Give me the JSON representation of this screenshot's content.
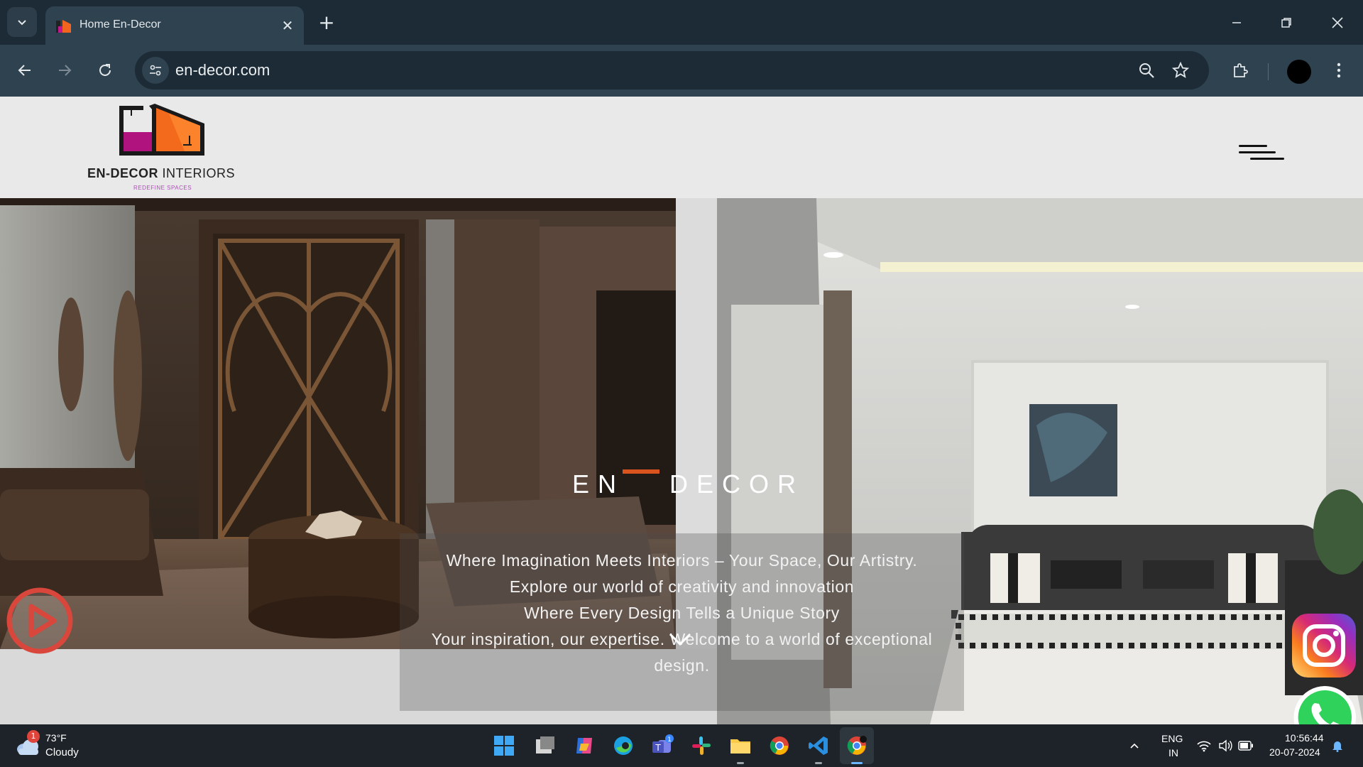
{
  "browser": {
    "tab_title": "Home En-Decor",
    "url": "en-decor.com",
    "icons": [
      "tab-search-icon",
      "close-icon",
      "plus-icon",
      "minimize-icon",
      "restore-icon",
      "close-window-icon",
      "back-icon",
      "forward-icon",
      "reload-icon",
      "site-settings-icon",
      "zoom-icon",
      "star-icon",
      "extensions-icon",
      "profile-avatar",
      "more-icon"
    ]
  },
  "site": {
    "brand_bold": "EN-DECOR",
    "brand_rest": " INTERIORS",
    "tagline": "REDEFINE SPACES",
    "hero_en": "EN",
    "hero_decor": "DECOR",
    "accent_color": "#d9531e",
    "captions": [
      "Where Imagination Meets Interiors – Your Space, Our Artistry.",
      "Explore our world of creativity and innovation",
      "Where Every Design Tells a Unique Story",
      "Your inspiration, our expertise. Welcome to a world of exceptional",
      "design."
    ]
  },
  "taskbar": {
    "weather_temp": "73°F",
    "weather_cond": "Cloudy",
    "weather_badge": "1",
    "teams_badge": "1",
    "lang_1": "ENG",
    "lang_2": "IN",
    "time": "10:56:44",
    "date": "20-07-2024",
    "apps": [
      "start-icon",
      "task-view-icon",
      "copilot-icon",
      "edge-icon",
      "teams-icon",
      "slack-icon",
      "file-explorer-icon",
      "chrome-icon",
      "vscode-icon",
      "chrome-active-icon"
    ]
  }
}
